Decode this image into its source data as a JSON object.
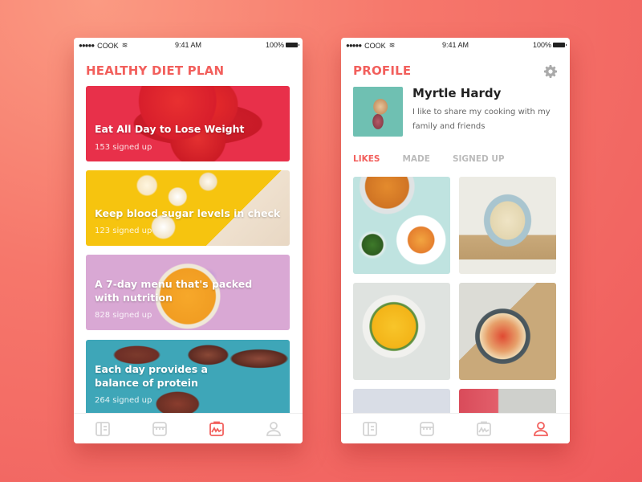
{
  "colors": {
    "accent": "#f25f5c",
    "inactive": "#c8c8c8",
    "background": "#f26a63"
  },
  "status_bar": {
    "signal": "●●●●●",
    "carrier": "COOK",
    "time": "9:41 AM",
    "battery": "100%"
  },
  "diet_screen": {
    "title": "HEALTHY DIET PLAN",
    "cards": [
      {
        "title": "Eat All Day to Lose Weight",
        "signed": "153 signed up"
      },
      {
        "title": "Keep blood sugar levels in check",
        "signed": "123 signed up"
      },
      {
        "title": "A 7-day menu that's packed with nutrition",
        "signed": "828 signed up"
      },
      {
        "title": "Each day provides a balance of protein",
        "signed": "264 signed up"
      }
    ],
    "active_tab": "stats"
  },
  "profile_screen": {
    "title": "PROFILE",
    "name": "Myrtle Hardy",
    "bio": "I like to share my cooking with my family and friends",
    "tabs": [
      "LIKES",
      "MADE",
      "SIGNED UP"
    ],
    "active_tab_index": 0,
    "grid_items": [
      "fish-stew",
      "creamy-pot",
      "yellow-soup",
      "pepper-frittata",
      "salad-plate",
      "veggie-plate"
    ],
    "active_nav": "profile"
  },
  "nav_icons": [
    "book-icon",
    "store-icon",
    "clipboard-chart-icon",
    "user-icon"
  ]
}
